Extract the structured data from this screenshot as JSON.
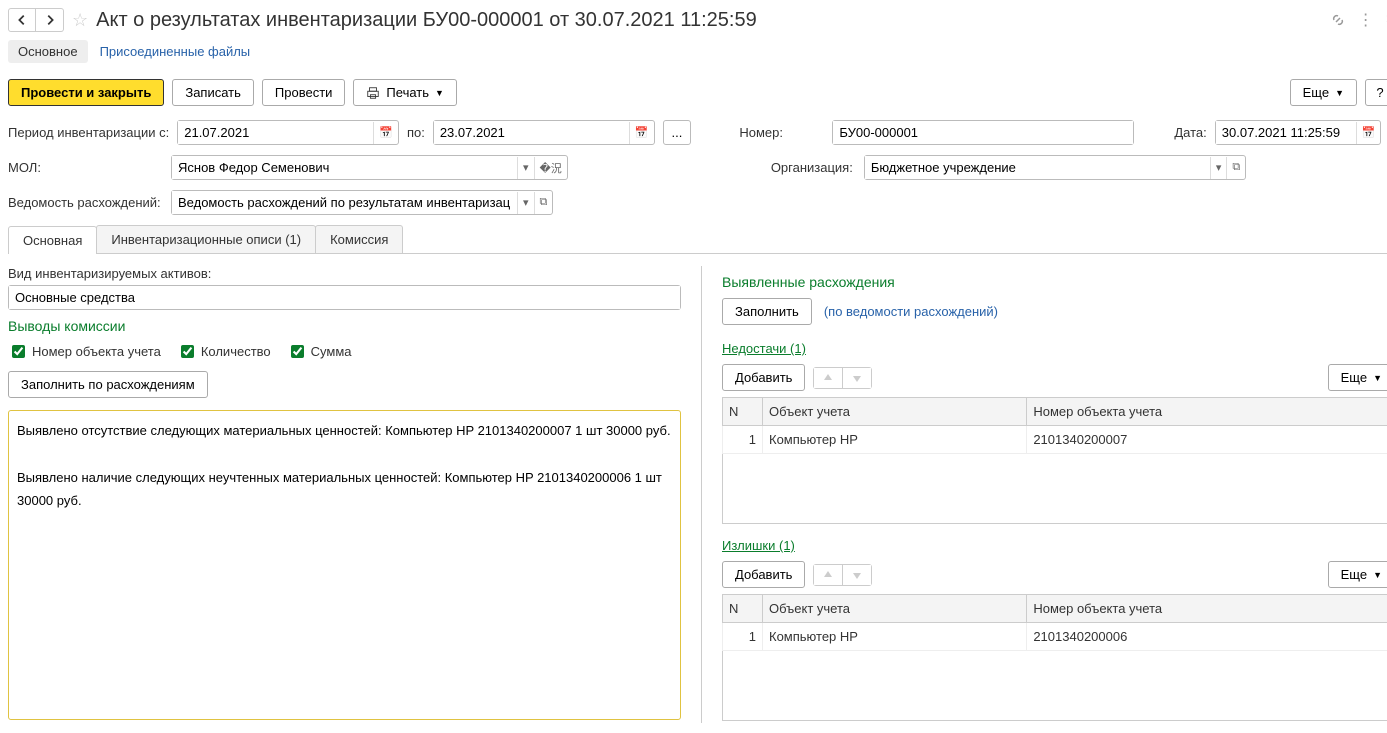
{
  "title": "Акт о результатах инвентаризации БУ00-000001 от 30.07.2021 11:25:59",
  "subnav": {
    "main": "Основное",
    "files": "Присоединенные файлы"
  },
  "toolbar": {
    "post_close": "Провести и закрыть",
    "save": "Записать",
    "post": "Провести",
    "print": "Печать",
    "more": "Еще",
    "help": "?"
  },
  "form": {
    "period_label": "Период инвентаризации с:",
    "period_from": "21.07.2021",
    "period_to_label": "по:",
    "period_to": "23.07.2021",
    "number_label": "Номер:",
    "number": "БУ00-000001",
    "date_label": "Дата:",
    "date": "30.07.2021 11:25:59",
    "mol_label": "МОЛ:",
    "mol": "Яснов Федор Семенович",
    "org_label": "Организация:",
    "org": "Бюджетное учреждение",
    "discrep_label": "Ведомость расхождений:",
    "discrep": "Ведомость расхождений по результатам инвентаризации БУ"
  },
  "tabs": {
    "t1": "Основная",
    "t2": "Инвентаризационные описи (1)",
    "t3": "Комиссия"
  },
  "left": {
    "asset_type_label": "Вид инвентаризируемых активов:",
    "asset_type": "Основные средства",
    "conclusions": "Выводы комиссии",
    "cb1": "Номер объекта учета",
    "cb2": "Количество",
    "cb3": "Сумма",
    "fill_discrep": "Заполнить по расхождениям",
    "text": "Выявлено отсутствие следующих материальных ценностей: Компьютер HP 2101340200007 1 шт 30000 руб.\n\nВыявлено наличие следующих неучтенных материальных ценностей: Компьютер HP 2101340200006 1 шт 30000 руб."
  },
  "right": {
    "discrep_title": "Выявленные расхождения",
    "fill": "Заполнить",
    "by_statement": "(по ведомости расхождений)",
    "shortage": "Недостачи (1)",
    "surplus": "Излишки (1)",
    "add": "Добавить",
    "more": "Еще",
    "col_n": "N",
    "col_obj": "Объект учета",
    "col_num": "Номер объекта учета",
    "shortage_rows": [
      {
        "n": "1",
        "obj": "Компьютер HP",
        "num": "2101340200007"
      }
    ],
    "surplus_rows": [
      {
        "n": "1",
        "obj": "Компьютер HP",
        "num": "2101340200006"
      }
    ]
  }
}
